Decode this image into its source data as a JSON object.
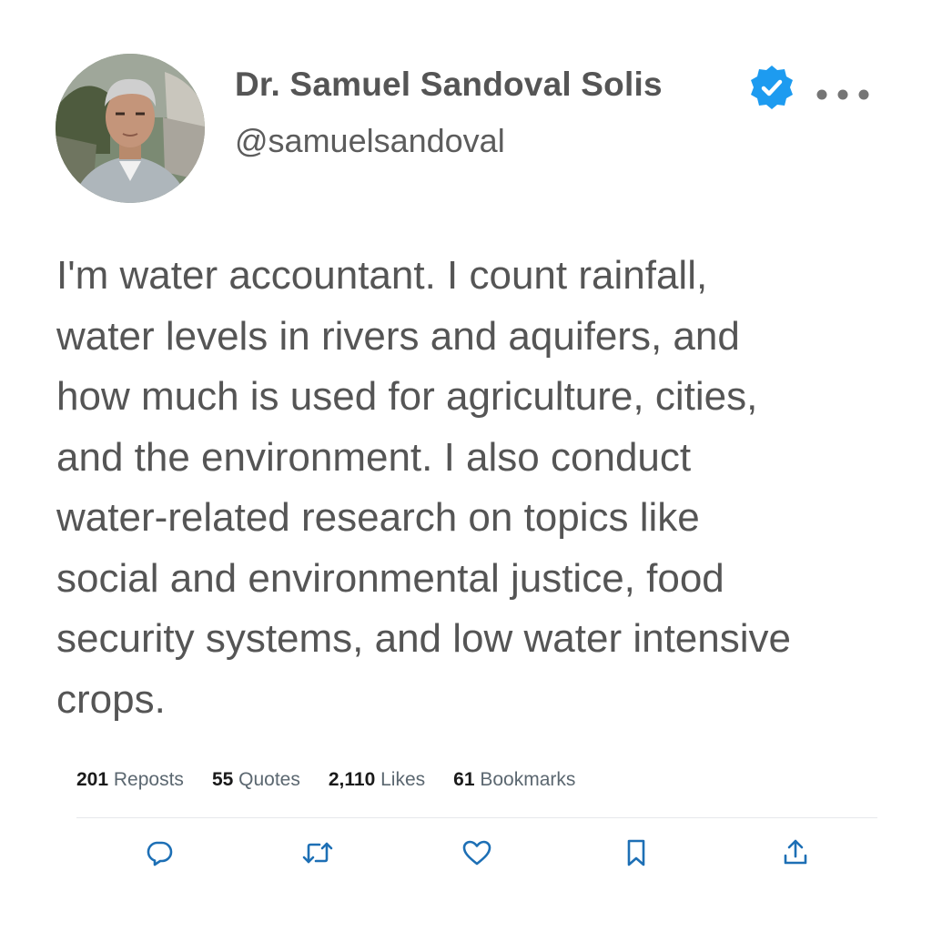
{
  "author": {
    "display_name": "Dr. Samuel Sandoval Solis",
    "handle": "@samuelsandoval",
    "avatar_icon": "profile-photo",
    "verified_icon": "verified-badge-icon",
    "verified_color": "#1d9bf0"
  },
  "menu_icon": "more-options-icon",
  "tweet": {
    "text": "I'm water accountant. I count rainfall,\nwater levels in rivers and aquifers, and\nhow much is used for agriculture, cities,\nand the environment. I also conduct\nwater-related research on topics like\nsocial and environmental justice, food\nsecurity systems, and low water intensive\ncrops."
  },
  "stats": {
    "reposts": {
      "count": "201",
      "label": "Reposts"
    },
    "quotes": {
      "count": "55",
      "label": "Quotes"
    },
    "likes": {
      "count": "2,110",
      "label": "Likes"
    },
    "bookmarks": {
      "count": "61",
      "label": "Bookmarks"
    }
  },
  "actions": {
    "reply": "reply-icon",
    "repost": "repost-icon",
    "like": "heart-icon",
    "bookmark": "bookmark-icon",
    "share": "share-icon"
  },
  "colors": {
    "text": "#555555",
    "icon": "#1d6fb5",
    "stat_label": "#5b6770"
  }
}
